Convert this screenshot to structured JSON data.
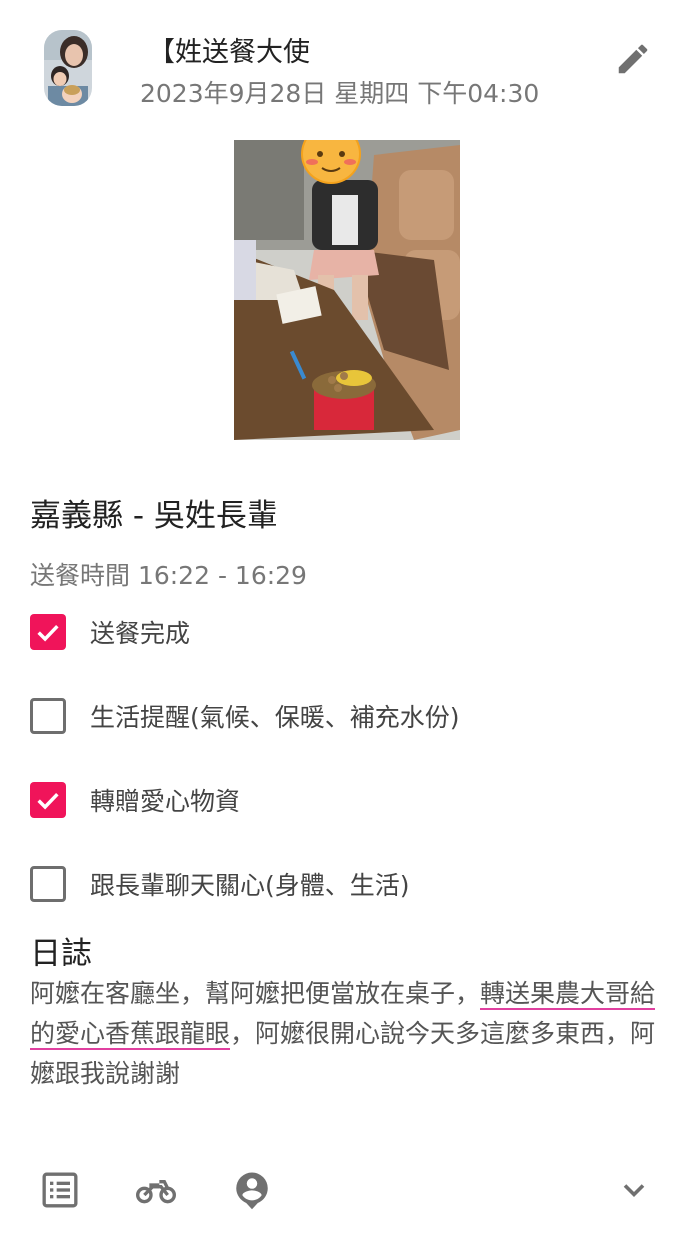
{
  "post": {
    "author": "【姓送餐大使",
    "datetime": "2023年9月28日 星期四 下午04:30"
  },
  "recipient": "嘉義縣 - 吳姓長輩",
  "delivery_time": "送餐時間 16:22 - 16:29",
  "checklist": [
    {
      "label": "送餐完成",
      "checked": true
    },
    {
      "label": "生活提醒(氣候、保暖、補充水份)",
      "checked": false
    },
    {
      "label": "轉贈愛心物資",
      "checked": true
    },
    {
      "label": "跟長輩聊天關心(身體、生活)",
      "checked": false
    }
  ],
  "log": {
    "title": "日誌",
    "part1": "阿嬤在客廳坐，幫阿嬤把便當放在桌子，",
    "highlight": "轉送果農大哥給的愛心香蕉跟龍眼",
    "part2": "，阿嬤很開心說今天多這麼多東西，阿嬤跟我說謝謝"
  },
  "icons": {
    "edit": "pencil-icon",
    "list": "list-icon",
    "ride": "motorcycle-icon",
    "profile": "account-icon",
    "expand": "chevron-down-icon"
  },
  "colors": {
    "accent": "#f0145a",
    "underline": "#e040a0",
    "muted_text": "#777777"
  }
}
